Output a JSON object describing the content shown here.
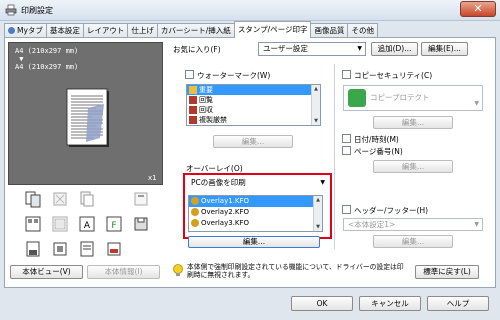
{
  "window": {
    "title": "印刷設定",
    "close_glyph": "✕"
  },
  "tabs": [
    "Myタブ",
    "基本設定",
    "レイアウト",
    "仕上げ",
    "カバーシート/挿入紙",
    "スタンプ/ページ印字",
    "画像品質",
    "その他"
  ],
  "active_tab": 5,
  "preview": {
    "paper_label": "A4 (210x297 mm)\n ▼\nA4 (210x297 mm)",
    "copies": "x1",
    "left_button": "本体ビュー(V)",
    "right_button": "本体情報(I)"
  },
  "favorites": {
    "label": "お気に入り(F)",
    "value": "ユーザー設定",
    "add_button": "追加(D)...",
    "edit_button": "編集(E)..."
  },
  "watermark": {
    "label": "ウォーターマーク(W)",
    "items": [
      "重要",
      "回覧",
      "回収",
      "複製厳禁"
    ],
    "selected": 0,
    "edit_button": "編集..."
  },
  "overlay": {
    "label": "オーバーレイ(O)",
    "mode": "PCの画像を印刷",
    "items": [
      "Overlay1.KFO",
      "Overlay2.KFO",
      "Overlay3.KFO"
    ],
    "selected": 0,
    "edit_button": "編集..."
  },
  "copy_security": {
    "label": "コピーセキュリティ(C)",
    "value": "コピープロテクト",
    "edit_button": "編集..."
  },
  "date_time": {
    "label": "日付/時刻(M)"
  },
  "page_number": {
    "label": "ページ番号(N)",
    "edit_button": "編集..."
  },
  "header_footer": {
    "label": "ヘッダー/フッター(H)",
    "value": "<本体設定1>",
    "edit_button": "編集..."
  },
  "info_text": "本体側で強制印刷設定されている機能について、ドライバーの設定は印刷時に無視されます。",
  "default_button": "標準に戻す(L)",
  "ok_button": "OK",
  "cancel_button": "キャンセル",
  "help_button": "ヘルプ",
  "colors": {
    "selection": "#3399ff",
    "highlight_border": "#e0001a"
  }
}
